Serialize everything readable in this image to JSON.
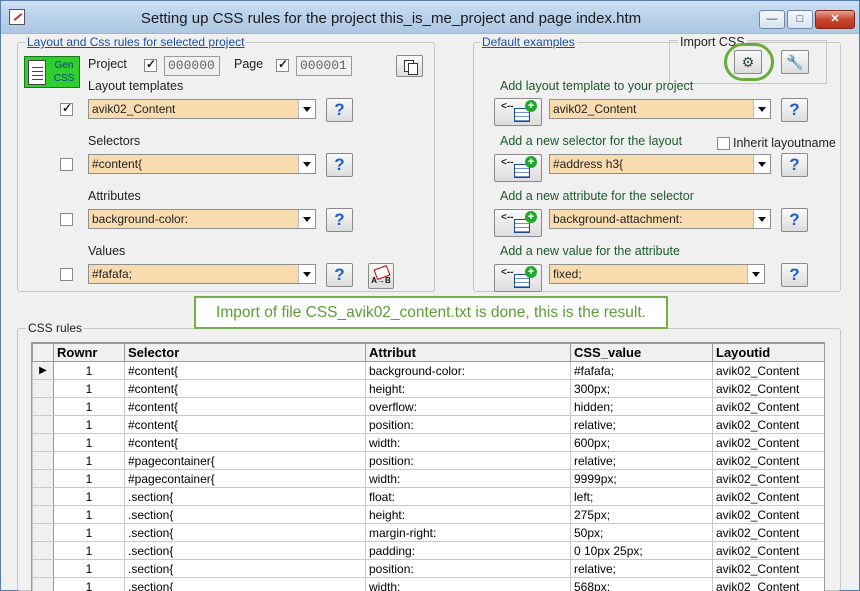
{
  "window": {
    "title": "Setting up CSS rules for the project this_is_me_project and page index.htm",
    "controls": {
      "minimize": "—",
      "maximize": "□",
      "close": "✕"
    }
  },
  "left_panel": {
    "title": "Layout and Css rules for selected project",
    "gen_button": "Gen CSS",
    "project_label": "Project",
    "project_checked": true,
    "project_value": "000000",
    "page_label": "Page",
    "page_checked": true,
    "page_value": "000001",
    "rows": [
      {
        "label": "Layout templates",
        "checked": true,
        "value": "avik02_Content"
      },
      {
        "label": "Selectors",
        "checked": false,
        "value": "#content{"
      },
      {
        "label": "Attributes",
        "checked": false,
        "value": "background-color:"
      },
      {
        "label": "Values",
        "checked": false,
        "value": "#fafafa;"
      }
    ],
    "help_glyph": "?"
  },
  "right_panel": {
    "title": "Default examples",
    "import_title": "Import CSS",
    "inherit_label": "Inherit layoutname",
    "inherit_checked": false,
    "add_arrow": "<--",
    "add_plus": "+",
    "rows": [
      {
        "label": "Add layout template to your project",
        "value": "avik02_Content"
      },
      {
        "label": "Add a new selector for the layout",
        "value": "#address h3{"
      },
      {
        "label": "Add a new attribute for the selector",
        "value": "background-attachment:"
      },
      {
        "label": "Add a new value for the attribute",
        "value": "fixed;"
      }
    ]
  },
  "callout": "Import of  file CSS_avik02_content.txt is done, this is the result.",
  "css_rules": {
    "title": "CSS rules",
    "current_row_marker": "▶",
    "columns": [
      "Rownr",
      "Selector",
      "Attribut",
      "CSS_value",
      "Layoutid"
    ],
    "rows": [
      [
        "1",
        "#content{",
        "background-color:",
        "#fafafa;",
        "avik02_Content"
      ],
      [
        "1",
        "#content{",
        "height:",
        "300px;",
        "avik02_Content"
      ],
      [
        "1",
        "#content{",
        "overflow:",
        "hidden;",
        "avik02_Content"
      ],
      [
        "1",
        "#content{",
        "position:",
        "relative;",
        "avik02_Content"
      ],
      [
        "1",
        "#content{",
        "width:",
        "600px;",
        "avik02_Content"
      ],
      [
        "1",
        "#pagecontainer{",
        "position:",
        "relative;",
        "avik02_Content"
      ],
      [
        "1",
        "#pagecontainer{",
        "width:",
        "9999px;",
        "avik02_Content"
      ],
      [
        "1",
        ".section{",
        "float:",
        "left;",
        "avik02_Content"
      ],
      [
        "1",
        ".section{",
        "height:",
        "275px;",
        "avik02_Content"
      ],
      [
        "1",
        ".section{",
        "margin-right:",
        "50px;",
        "avik02_Content"
      ],
      [
        "1",
        ".section{",
        "padding:",
        "0 10px 25px;",
        "avik02_Content"
      ],
      [
        "1",
        ".section{",
        "position:",
        "relative;",
        "avik02_Content"
      ],
      [
        "1",
        ".section{",
        "width:",
        "568px;",
        "avik02_Content"
      ]
    ]
  }
}
